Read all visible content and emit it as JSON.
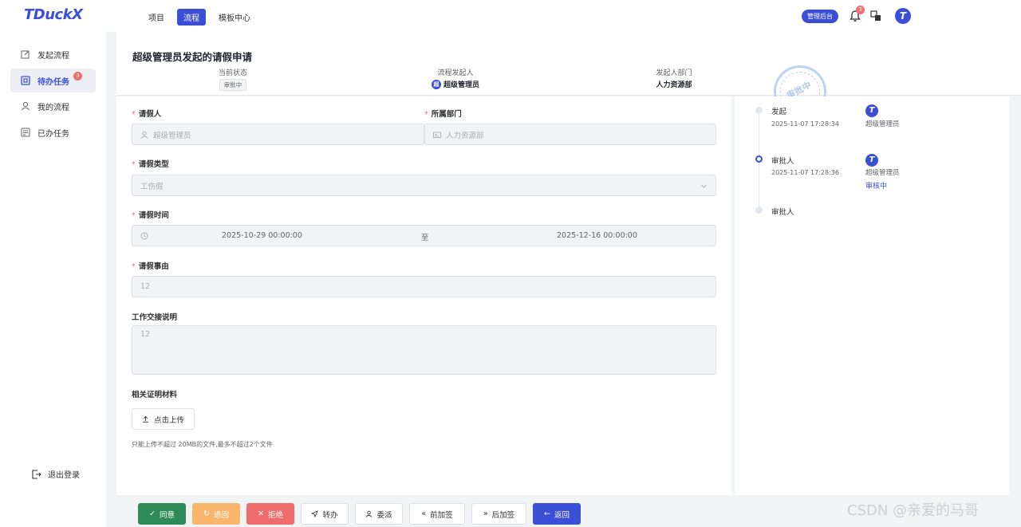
{
  "app": {
    "logo": "TDuckX"
  },
  "topnav": {
    "items": [
      "项目",
      "流程",
      "模板中心"
    ],
    "active": "流程"
  },
  "header_right": {
    "admin_label": "管理后台",
    "notification_count": "3",
    "avatar_letter": "T"
  },
  "sidebar": {
    "items": [
      {
        "label": "发起流程",
        "icon": "edit-icon"
      },
      {
        "label": "待办任务",
        "icon": "todo-icon",
        "badge": "3"
      },
      {
        "label": "我的流程",
        "icon": "user-icon"
      },
      {
        "label": "已办任务",
        "icon": "done-icon"
      }
    ],
    "logout_label": "退出登录"
  },
  "page": {
    "title": "超级管理员发起的请假申请",
    "status_label": "当前状态",
    "status_value": "审批中",
    "initiator_label": "流程发起人",
    "initiator_avatar": "超",
    "initiator_value": "超级管理员",
    "dept_label": "发起人部门",
    "dept_value": "人力资源部",
    "stamp_text": "审批中"
  },
  "form": {
    "applicant_label": "请假人",
    "applicant_value": "超级管理员",
    "dept_label": "所属部门",
    "dept_value": "人力资源部",
    "type_label": "请假类型",
    "type_value": "工伤假",
    "time_label": "请假时间",
    "time_start": "2025-10-29 00:00:00",
    "time_sep": "至",
    "time_end": "2025-12-16 00:00:00",
    "reason_label": "请假事由",
    "reason_value": "12",
    "handover_label": "工作交接说明",
    "handover_value": "12",
    "attachment_label": "相关证明材料",
    "upload_label": "点击上传",
    "upload_tip": "只能上传不超过 20MB的文件,最多不超过2个文件"
  },
  "timeline": [
    {
      "title": "发起",
      "time": "2025-11-07 17:28:34",
      "user": "超级管理员",
      "status": ""
    },
    {
      "title": "审批人",
      "time": "2025-11-07 17:28:36",
      "user": "超级管理员",
      "status": "审核中"
    },
    {
      "title": "审批人",
      "time": "",
      "user": "",
      "status": ""
    }
  ],
  "actions": {
    "approve": "同意",
    "return": "退回",
    "reject": "拒绝",
    "transfer": "转办",
    "delegate": "委派",
    "add_before": "前加签",
    "add_after": "后加签",
    "back": "返回"
  },
  "watermark": "CSDN @亲爱的马哥",
  "colors": {
    "primary": "#3a4fd6",
    "approve": "#2e8b57",
    "return": "#f8b56b",
    "reject": "#f06b6b",
    "badge": "#f56c6c"
  }
}
